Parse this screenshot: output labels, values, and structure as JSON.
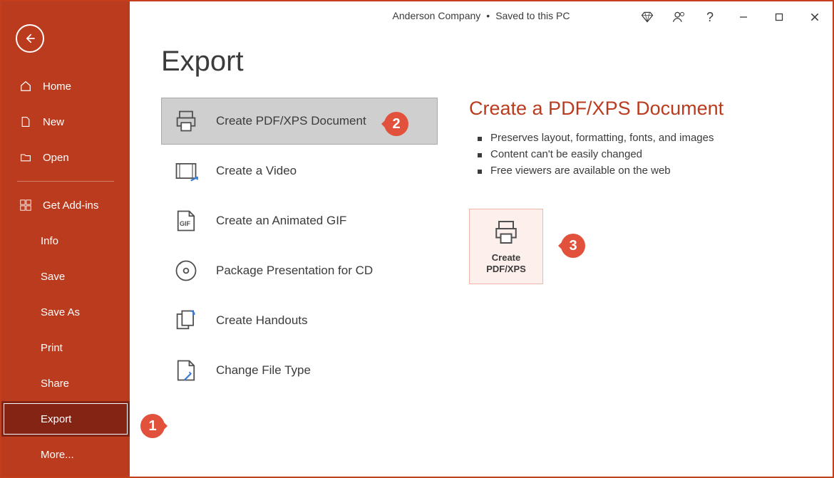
{
  "titlebar": {
    "doc_name": "Anderson Company",
    "save_status": "Saved to this PC"
  },
  "sidebar": {
    "items": [
      {
        "label": "Home"
      },
      {
        "label": "New"
      },
      {
        "label": "Open"
      },
      {
        "label": "Get Add-ins"
      },
      {
        "label": "Info"
      },
      {
        "label": "Save"
      },
      {
        "label": "Save As"
      },
      {
        "label": "Print"
      },
      {
        "label": "Share"
      },
      {
        "label": "Export"
      },
      {
        "label": "More..."
      }
    ]
  },
  "page": {
    "title": "Export"
  },
  "options": [
    {
      "label": "Create PDF/XPS Document"
    },
    {
      "label": "Create a Video"
    },
    {
      "label": "Create an Animated GIF"
    },
    {
      "label": "Package Presentation for CD"
    },
    {
      "label": "Create Handouts"
    },
    {
      "label": "Change File Type"
    }
  ],
  "detail": {
    "title": "Create a PDF/XPS Document",
    "bullets": [
      "Preserves layout, formatting, fonts, and images",
      "Content can't be easily changed",
      "Free viewers are available on the web"
    ],
    "action_label": "Create\nPDF/XPS"
  },
  "callouts": {
    "c1": "1",
    "c2": "2",
    "c3": "3"
  },
  "colors": {
    "brand": "#bb3b1e",
    "callout": "#e2513b"
  }
}
